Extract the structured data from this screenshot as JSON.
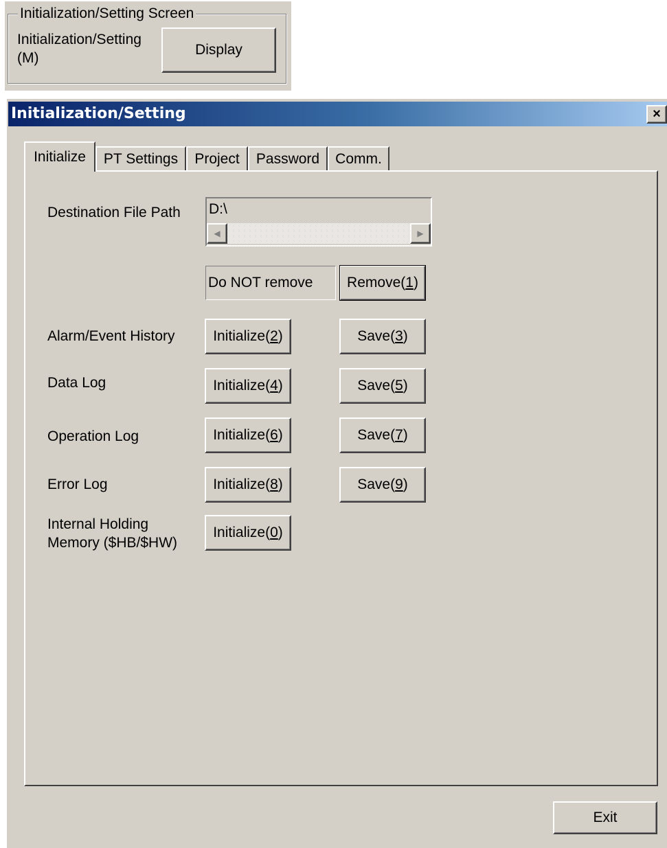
{
  "top_group": {
    "title": "Initialization/Setting Screen",
    "label_line1": "Initialization/Setting",
    "label_line2": "(M)",
    "display_button": "Display"
  },
  "dialog": {
    "title": "Initialization/Setting",
    "close_glyph": "×",
    "tabs": [
      "Initialize",
      "PT Settings",
      "Project",
      "Password",
      "Comm."
    ],
    "active_tab": "Initialize",
    "destination": {
      "label": "Destination File Path",
      "value": "D:\\"
    },
    "remove_status": "Do NOT remove",
    "remove_button": {
      "text": "Remove(",
      "key": "1",
      "end": ")"
    },
    "rows": [
      {
        "label": "Alarm/Event History",
        "init": {
          "text": "Initialize(",
          "key": "2",
          "end": ")"
        },
        "save": {
          "text": "Save(",
          "key": "3",
          "end": ")"
        }
      },
      {
        "label": "Data Log",
        "init": {
          "text": "Initialize(",
          "key": "4",
          "end": ")"
        },
        "save": {
          "text": "Save(",
          "key": "5",
          "end": ")"
        }
      },
      {
        "label": "Operation Log",
        "init": {
          "text": "Initialize(",
          "key": "6",
          "end": ")"
        },
        "save": {
          "text": "Save(",
          "key": "7",
          "end": ")"
        }
      },
      {
        "label": "Error Log",
        "init": {
          "text": "Initialize(",
          "key": "8",
          "end": ")"
        },
        "save": {
          "text": "Save(",
          "key": "9",
          "end": ")"
        }
      }
    ],
    "holding": {
      "label_line1": "Internal Holding",
      "label_line2": "Memory ($HB/$HW)",
      "init": {
        "text": "Initialize(",
        "key": "0",
        "end": ")"
      }
    },
    "exit_button": "Exit"
  },
  "colors": {
    "face": "#d4d0c8",
    "titlebar_start": "#0a246a",
    "titlebar_end": "#a6caf0"
  }
}
